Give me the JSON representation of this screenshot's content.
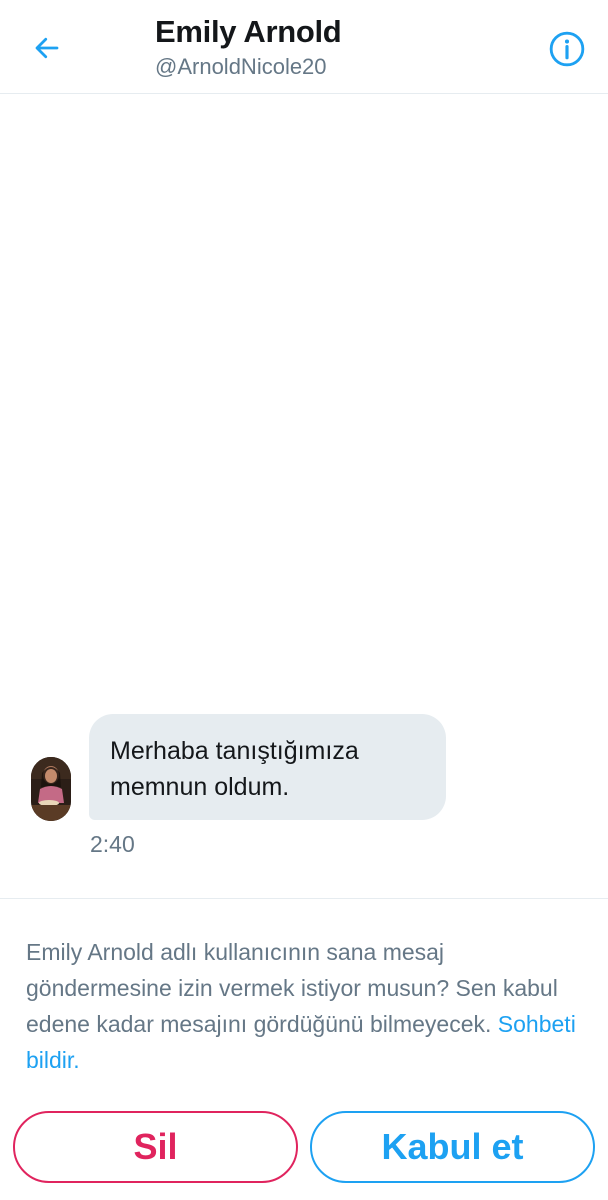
{
  "colors": {
    "accent": "#1da1f2",
    "danger": "#e0245e",
    "text_primary": "#14171a",
    "text_secondary": "#657786",
    "bubble_bg": "#e6ecf0"
  },
  "header": {
    "back_icon": "arrow-left-icon",
    "title": "Emily Arnold",
    "handle": "@ArnoldNicole20",
    "info_icon": "info-icon"
  },
  "conversation": {
    "messages": [
      {
        "text": "Merhaba tanıştığımıza memnun oldum.",
        "time": "2:40"
      }
    ]
  },
  "request": {
    "prompt_text": "Emily Arnold adlı kullanıcının sana mesaj göndermesine izin vermek istiyor musun? Sen kabul edene kadar mesajını gördüğünü bilmeyecek.",
    "report_link": "Sohbeti bildir.",
    "delete_label": "Sil",
    "accept_label": "Kabul et"
  }
}
